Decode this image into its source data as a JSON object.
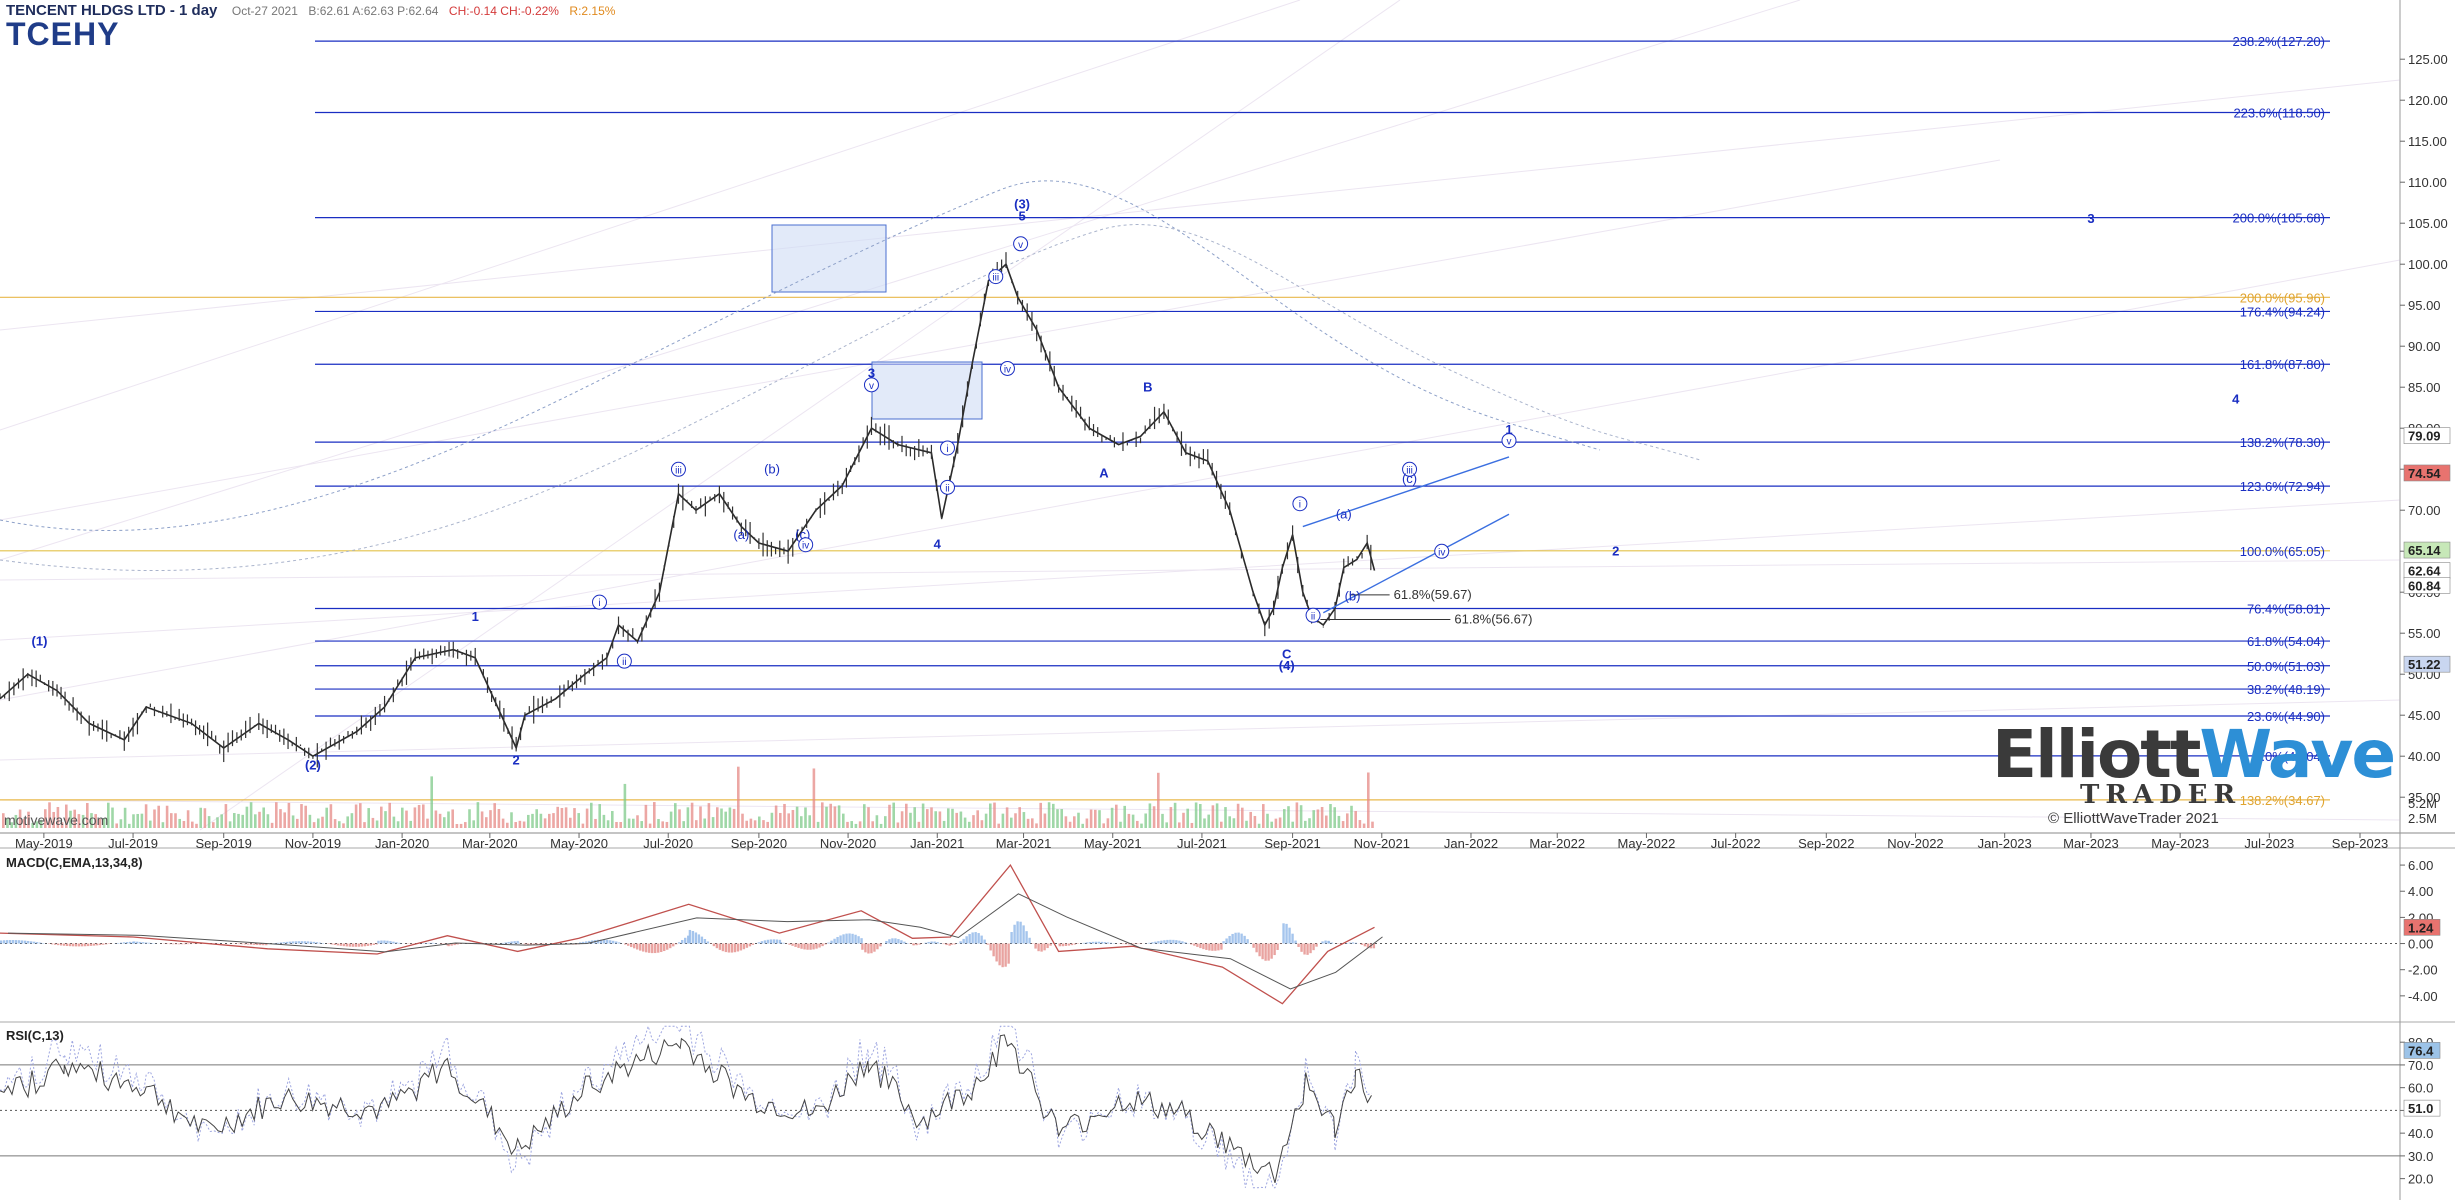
{
  "header": {
    "title": "TENCENT HLDGS LTD - 1 day",
    "date": "Oct-27 2021",
    "quote": "B:62.61 A:62.63 P:62.64",
    "change": "CH:-0.14 CH:-0.22%",
    "pct": "R:2.15%",
    "symbol": "TCEHY"
  },
  "brand": {
    "watermark": "motivewave.com",
    "logo_part1": "Elliott",
    "logo_part2": "Wave",
    "logo_sub": "TRADER",
    "logo_copy": "© ElliottWaveTrader 2021",
    "accent": "#2d8fd6"
  },
  "chart_data": [
    {
      "type": "line",
      "name": "price",
      "yscale": "linear",
      "ylim": [
        31,
        131
      ],
      "x_axis": [
        "May-2019",
        "Jul-2019",
        "Sep-2019",
        "Nov-2019",
        "Jan-2020",
        "Mar-2020",
        "May-2020",
        "Jul-2020",
        "Sep-2020",
        "Nov-2020",
        "Jan-2021",
        "Mar-2021",
        "May-2021",
        "Jul-2021",
        "Sep-2021",
        "Nov-2021",
        "Jan-2022",
        "Mar-2022",
        "May-2022",
        "Jul-2022",
        "Sep-2022",
        "Nov-2022",
        "Jan-2023",
        "Mar-2023",
        "May-2023",
        "Jul-2023",
        "Sep-2023"
      ],
      "y_ticks": [
        35,
        40,
        45,
        50,
        55,
        60,
        65,
        70,
        75,
        80,
        85,
        90,
        95,
        100,
        105,
        110,
        115,
        120,
        125
      ],
      "series": [
        {
          "x": [
            "2019-04-01",
            "2019-04-20",
            "2019-05-10",
            "2019-06-01",
            "2019-06-25",
            "2019-07-10",
            "2019-08-10",
            "2019-09-01",
            "2019-09-25",
            "2019-10-15",
            "2019-11-01",
            "2019-12-01",
            "2019-12-20",
            "2020-01-10",
            "2020-02-05",
            "2020-02-20",
            "2020-03-19",
            "2020-03-25",
            "2020-04-15",
            "2020-05-05",
            "2020-05-20",
            "2020-05-28",
            "2020-06-10",
            "2020-06-25",
            "2020-07-08",
            "2020-07-20",
            "2020-08-05",
            "2020-08-20",
            "2020-09-01",
            "2020-09-21",
            "2020-10-10",
            "2020-10-28",
            "2020-11-17",
            "2020-12-05",
            "2020-12-28",
            "2021-01-04",
            "2021-01-15",
            "2021-01-25",
            "2021-02-05",
            "2021-02-17",
            "2021-02-25",
            "2021-03-10",
            "2021-03-25",
            "2021-04-15",
            "2021-05-05",
            "2021-05-20",
            "2021-06-05",
            "2021-06-20",
            "2021-07-05",
            "2021-07-20",
            "2021-07-28",
            "2021-08-05",
            "2021-08-13",
            "2021-08-19",
            "2021-08-25",
            "2021-09-01",
            "2021-09-08",
            "2021-09-14",
            "2021-09-22",
            "2021-09-30",
            "2021-10-06",
            "2021-10-15",
            "2021-10-22",
            "2021-10-27"
          ],
          "values": [
            47,
            50,
            48,
            44,
            42,
            46,
            44,
            41,
            44,
            42,
            40,
            43,
            46,
            52,
            53,
            52,
            41,
            45,
            47,
            50,
            52,
            56,
            54,
            60,
            72,
            70,
            72,
            68,
            66,
            65,
            70,
            73,
            80,
            78,
            77,
            69,
            78,
            88,
            98,
            100,
            96,
            92,
            85,
            80,
            78,
            79,
            82,
            77,
            76,
            70,
            65,
            60,
            56,
            58,
            63,
            67,
            60,
            57,
            56,
            58,
            63,
            64,
            66,
            62.64
          ]
        }
      ],
      "annotations": [
        {
          "t": "2019-04-28",
          "p": 53.5,
          "text": "(1)"
        },
        {
          "t": "2019-11-01",
          "p": 38.4,
          "text": "(2)"
        },
        {
          "t": "2020-02-20",
          "p": 56.5,
          "text": "1"
        },
        {
          "t": "2020-03-19",
          "p": 39.0,
          "text": "2"
        },
        {
          "t": "2020-05-15",
          "p": 58.3,
          "text": "i"
        },
        {
          "t": "2020-06-01",
          "p": 51.1,
          "text": "ii"
        },
        {
          "t": "2020-07-08",
          "p": 74.5,
          "text": "iii"
        },
        {
          "t": "2020-08-20",
          "p": 66.5,
          "text": "(a)"
        },
        {
          "t": "2020-09-10",
          "p": 74.5,
          "text": "(b)"
        },
        {
          "t": "2020-10-01",
          "p": 66.5,
          "text": "(c)"
        },
        {
          "t": "2020-10-03",
          "p": 65.3,
          "text": "iv"
        },
        {
          "t": "2020-11-17",
          "p": 86.2,
          "text": "3"
        },
        {
          "t": "2020-11-17",
          "p": 84.8,
          "text": "v"
        },
        {
          "t": "2021-01-01",
          "p": 65.3,
          "text": "4"
        },
        {
          "t": "2021-01-08",
          "p": 77.1,
          "text": "i"
        },
        {
          "t": "2021-01-08",
          "p": 72.3,
          "text": "ii"
        },
        {
          "t": "2021-02-10",
          "p": 98.0,
          "text": "iii"
        },
        {
          "t": "2021-02-18",
          "p": 86.8,
          "text": "iv"
        },
        {
          "t": "2021-02-27",
          "p": 102.0,
          "text": "v"
        },
        {
          "t": "2021-02-28",
          "p": 105.3,
          "text": "5"
        },
        {
          "t": "2021-02-28",
          "p": 106.8,
          "text": "(3)"
        },
        {
          "t": "2021-04-25",
          "p": 74.0,
          "text": "A"
        },
        {
          "t": "2021-05-25",
          "p": 84.5,
          "text": "B"
        },
        {
          "t": "2021-08-28",
          "p": 51.9,
          "text": "C"
        },
        {
          "t": "2021-08-28",
          "p": 50.5,
          "text": "(4)"
        },
        {
          "t": "2021-09-06",
          "p": 70.3,
          "text": "i"
        },
        {
          "t": "2021-09-15",
          "p": 56.7,
          "text": "ii"
        },
        {
          "t": "2021-10-06",
          "p": 69.0,
          "text": "(a)"
        },
        {
          "t": "2021-10-12",
          "p": 59.0,
          "text": "(b)"
        },
        {
          "t": "2021-11-20",
          "p": 74.5,
          "text": "iii"
        },
        {
          "t": "2021-11-20",
          "p": 73.3,
          "text": "(c)"
        },
        {
          "t": "2021-12-12",
          "p": 64.5,
          "text": "iv"
        },
        {
          "t": "2022-01-27",
          "p": 79.3,
          "text": "1"
        },
        {
          "t": "2022-01-27",
          "p": 78.0,
          "text": "v"
        },
        {
          "t": "2022-04-10",
          "p": 64.5,
          "text": "2"
        },
        {
          "t": "2023-03-01",
          "p": 105.0,
          "text": "3"
        },
        {
          "t": "2023-06-08",
          "p": 83.0,
          "text": "4"
        }
      ],
      "fib_levels": [
        {
          "label": "238.2%(127.20)",
          "value": 127.2
        },
        {
          "label": "223.6%(118.50)",
          "value": 118.5
        },
        {
          "label": "200.0%(105.68)",
          "value": 105.68
        },
        {
          "label": "176.4%(94.24)",
          "value": 94.24
        },
        {
          "label": "161.8%(87.80)",
          "value": 87.8
        },
        {
          "label": "138.2%(78.30)",
          "value": 78.3
        },
        {
          "label": "123.6%(72.94)",
          "value": 72.94
        },
        {
          "label": "100.0%(65.05)",
          "value": 65.05
        },
        {
          "label": "76.4%(58.01)",
          "value": 58.01
        },
        {
          "label": "61.8%(54.04)",
          "value": 54.04
        },
        {
          "label": "50.0%(51.03)",
          "value": 51.03
        },
        {
          "label": "38.2%(48.19)",
          "value": 48.19
        },
        {
          "label": "23.6%(44.90)",
          "value": 44.9
        },
        {
          "label": "0.0%(40.04)",
          "value": 40.04
        }
      ],
      "orange_levels": [
        {
          "label": "200.0%(95.96)",
          "value": 95.96
        },
        {
          "label": "138.2%(34.67)",
          "value": 34.67
        }
      ],
      "extra_fibs": [
        {
          "label": "61.8%(59.67)",
          "value": 59.67
        },
        {
          "label": "61.8%(56.67)",
          "value": 56.67
        }
      ],
      "price_badges": [
        {
          "label": "79.09",
          "value": 79.09,
          "color": "#ffffff"
        },
        {
          "label": "74.54",
          "value": 74.54,
          "color": "#e8736f"
        },
        {
          "label": "65.14",
          "value": 65.14,
          "color": "#c7e8b8"
        },
        {
          "label": "62.64",
          "value": 62.64,
          "color": "#ffffff"
        },
        {
          "label": "60.84",
          "value": 60.84,
          "color": "#ffffff"
        },
        {
          "label": "51.22",
          "value": 51.22,
          "color": "#c9d6f0"
        }
      ],
      "volume_ticks": [
        "5.2M",
        "2.5M"
      ]
    },
    {
      "type": "line",
      "name": "macd",
      "title": "MACD(C,EMA,13,34,8)",
      "ylim": [
        -6,
        7
      ],
      "y_ticks": [
        "6.00",
        "4.00",
        "2.00",
        "0.00",
        "-2.00",
        "-4.00"
      ],
      "badge": "1.24",
      "series": [
        {
          "x": [
            "2019-04-01",
            "2019-07-01",
            "2019-10-01",
            "2019-12-15",
            "2020-02-01",
            "2020-03-20",
            "2020-05-01",
            "2020-07-15",
            "2020-09-15",
            "2020-11-10",
            "2020-12-15",
            "2021-01-10",
            "2021-02-20",
            "2021-03-25",
            "2021-05-15",
            "2021-07-15",
            "2021-08-25",
            "2021-09-25",
            "2021-10-27"
          ],
          "values": [
            0.8,
            0.5,
            -0.4,
            -0.8,
            0.6,
            -0.6,
            0.4,
            3.0,
            0.8,
            2.5,
            0.4,
            0.5,
            6.0,
            -0.6,
            -0.2,
            -1.8,
            -4.6,
            -0.6,
            1.24
          ]
        }
      ]
    },
    {
      "type": "line",
      "name": "rsi",
      "title": "RSI(C,13)",
      "ylim": [
        15,
        88
      ],
      "y_ticks": [
        "80.0",
        "70.0",
        "60.0",
        "50.0",
        "40.0",
        "30.0",
        "20.0"
      ],
      "badge": "76.4",
      "badge2": "51.0",
      "series": [
        {
          "x": [
            "2019-04-01",
            "2019-05-15",
            "2019-07-10",
            "2019-08-20",
            "2019-10-10",
            "2019-12-20",
            "2020-02-01",
            "2020-03-20",
            "2020-05-10",
            "2020-07-10",
            "2020-08-25",
            "2020-10-10",
            "2020-11-15",
            "2020-12-20",
            "2021-01-25",
            "2021-02-18",
            "2021-03-25",
            "2021-05-10",
            "2021-06-20",
            "2021-07-28",
            "2021-08-20",
            "2021-09-10",
            "2021-09-30",
            "2021-10-14",
            "2021-10-27"
          ],
          "values": [
            55,
            70,
            60,
            40,
            55,
            50,
            70,
            32,
            62,
            80,
            55,
            48,
            72,
            45,
            60,
            82,
            40,
            55,
            48,
            30,
            22,
            62,
            42,
            66,
            52
          ]
        }
      ]
    }
  ]
}
